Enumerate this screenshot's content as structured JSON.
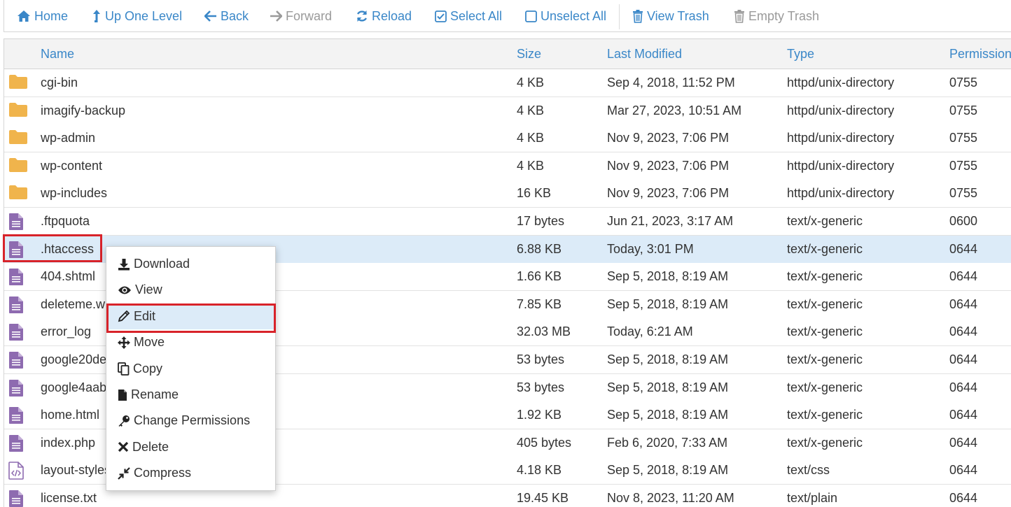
{
  "toolbar": {
    "home": "Home",
    "up_one_level": "Up One Level",
    "back": "Back",
    "forward": "Forward",
    "reload": "Reload",
    "select_all": "Select All",
    "unselect_all": "Unselect All",
    "view_trash": "View Trash",
    "empty_trash": "Empty Trash"
  },
  "columns": {
    "name": "Name",
    "size": "Size",
    "last_modified": "Last Modified",
    "type": "Type",
    "permissions": "Permission"
  },
  "rows": [
    {
      "icon": "folder-icon",
      "name": "cgi-bin",
      "size": "4 KB",
      "modified": "Sep 4, 2018, 11:52 PM",
      "type": "httpd/unix-directory",
      "perm": "0755"
    },
    {
      "icon": "folder-icon",
      "name": "imagify-backup",
      "size": "4 KB",
      "modified": "Mar 27, 2023, 10:51 AM",
      "type": "httpd/unix-directory",
      "perm": "0755"
    },
    {
      "icon": "folder-icon",
      "name": "wp-admin",
      "size": "4 KB",
      "modified": "Nov 9, 2023, 7:06 PM",
      "type": "httpd/unix-directory",
      "perm": "0755"
    },
    {
      "icon": "folder-icon",
      "name": "wp-content",
      "size": "4 KB",
      "modified": "Nov 9, 2023, 7:06 PM",
      "type": "httpd/unix-directory",
      "perm": "0755"
    },
    {
      "icon": "folder-icon",
      "name": "wp-includes",
      "size": "16 KB",
      "modified": "Nov 9, 2023, 7:06 PM",
      "type": "httpd/unix-directory",
      "perm": "0755"
    },
    {
      "icon": "file-text-icon",
      "name": ".ftpquota",
      "size": "17 bytes",
      "modified": "Jun 21, 2023, 3:17 AM",
      "type": "text/x-generic",
      "perm": "0600"
    },
    {
      "icon": "file-text-icon",
      "name": ".htaccess",
      "size": "6.88 KB",
      "modified": "Today, 3:01 PM",
      "type": "text/x-generic",
      "perm": "0644",
      "selected": true
    },
    {
      "icon": "file-text-icon",
      "name": "404.shtml",
      "size": "1.66 KB",
      "modified": "Sep 5, 2018, 8:19 AM",
      "type": "text/x-generic",
      "perm": "0644"
    },
    {
      "icon": "file-text-icon",
      "name": "deleteme.w",
      "size": "7.85 KB",
      "modified": "Sep 5, 2018, 8:19 AM",
      "type": "text/x-generic",
      "perm": "0644"
    },
    {
      "icon": "file-text-icon",
      "name": "error_log",
      "size": "32.03 MB",
      "modified": "Today, 6:21 AM",
      "type": "text/x-generic",
      "perm": "0644"
    },
    {
      "icon": "file-text-icon",
      "name": "google20de",
      "size": "53 bytes",
      "modified": "Sep 5, 2018, 8:19 AM",
      "type": "text/x-generic",
      "perm": "0644"
    },
    {
      "icon": "file-text-icon",
      "name": "google4aab",
      "size": "53 bytes",
      "modified": "Sep 5, 2018, 8:19 AM",
      "type": "text/x-generic",
      "perm": "0644"
    },
    {
      "icon": "file-text-icon",
      "name": "home.html",
      "size": "1.92 KB",
      "modified": "Sep 5, 2018, 8:19 AM",
      "type": "text/x-generic",
      "perm": "0644"
    },
    {
      "icon": "file-text-icon",
      "name": "index.php",
      "size": "405 bytes",
      "modified": "Feb 6, 2020, 7:33 AM",
      "type": "text/x-generic",
      "perm": "0644"
    },
    {
      "icon": "file-code-icon",
      "name": "layout-styles",
      "size": "4.18 KB",
      "modified": "Sep 5, 2018, 8:19 AM",
      "type": "text/css",
      "perm": "0644"
    },
    {
      "icon": "file-text-icon",
      "name": "license.txt",
      "size": "19.45 KB",
      "modified": "Nov 8, 2023, 11:20 AM",
      "type": "text/plain",
      "perm": "0644"
    }
  ],
  "context_menu": {
    "items": [
      {
        "icon": "download-icon",
        "label": "Download"
      },
      {
        "icon": "eye-icon",
        "label": "View"
      },
      {
        "icon": "pencil-icon",
        "label": "Edit",
        "active": true
      },
      {
        "icon": "move-icon",
        "label": "Move"
      },
      {
        "icon": "copy-icon",
        "label": "Copy"
      },
      {
        "icon": "file-icon",
        "label": "Rename"
      },
      {
        "icon": "key-icon",
        "label": "Change Permissions"
      },
      {
        "icon": "close-icon",
        "label": "Delete"
      },
      {
        "icon": "compress-icon",
        "label": "Compress"
      }
    ]
  },
  "colors": {
    "link_blue": "#3a87c8",
    "folder": "#f0b44c",
    "file": "#8e6bb0",
    "highlight_red": "#d8232a",
    "selected_row": "#dcebf8"
  }
}
